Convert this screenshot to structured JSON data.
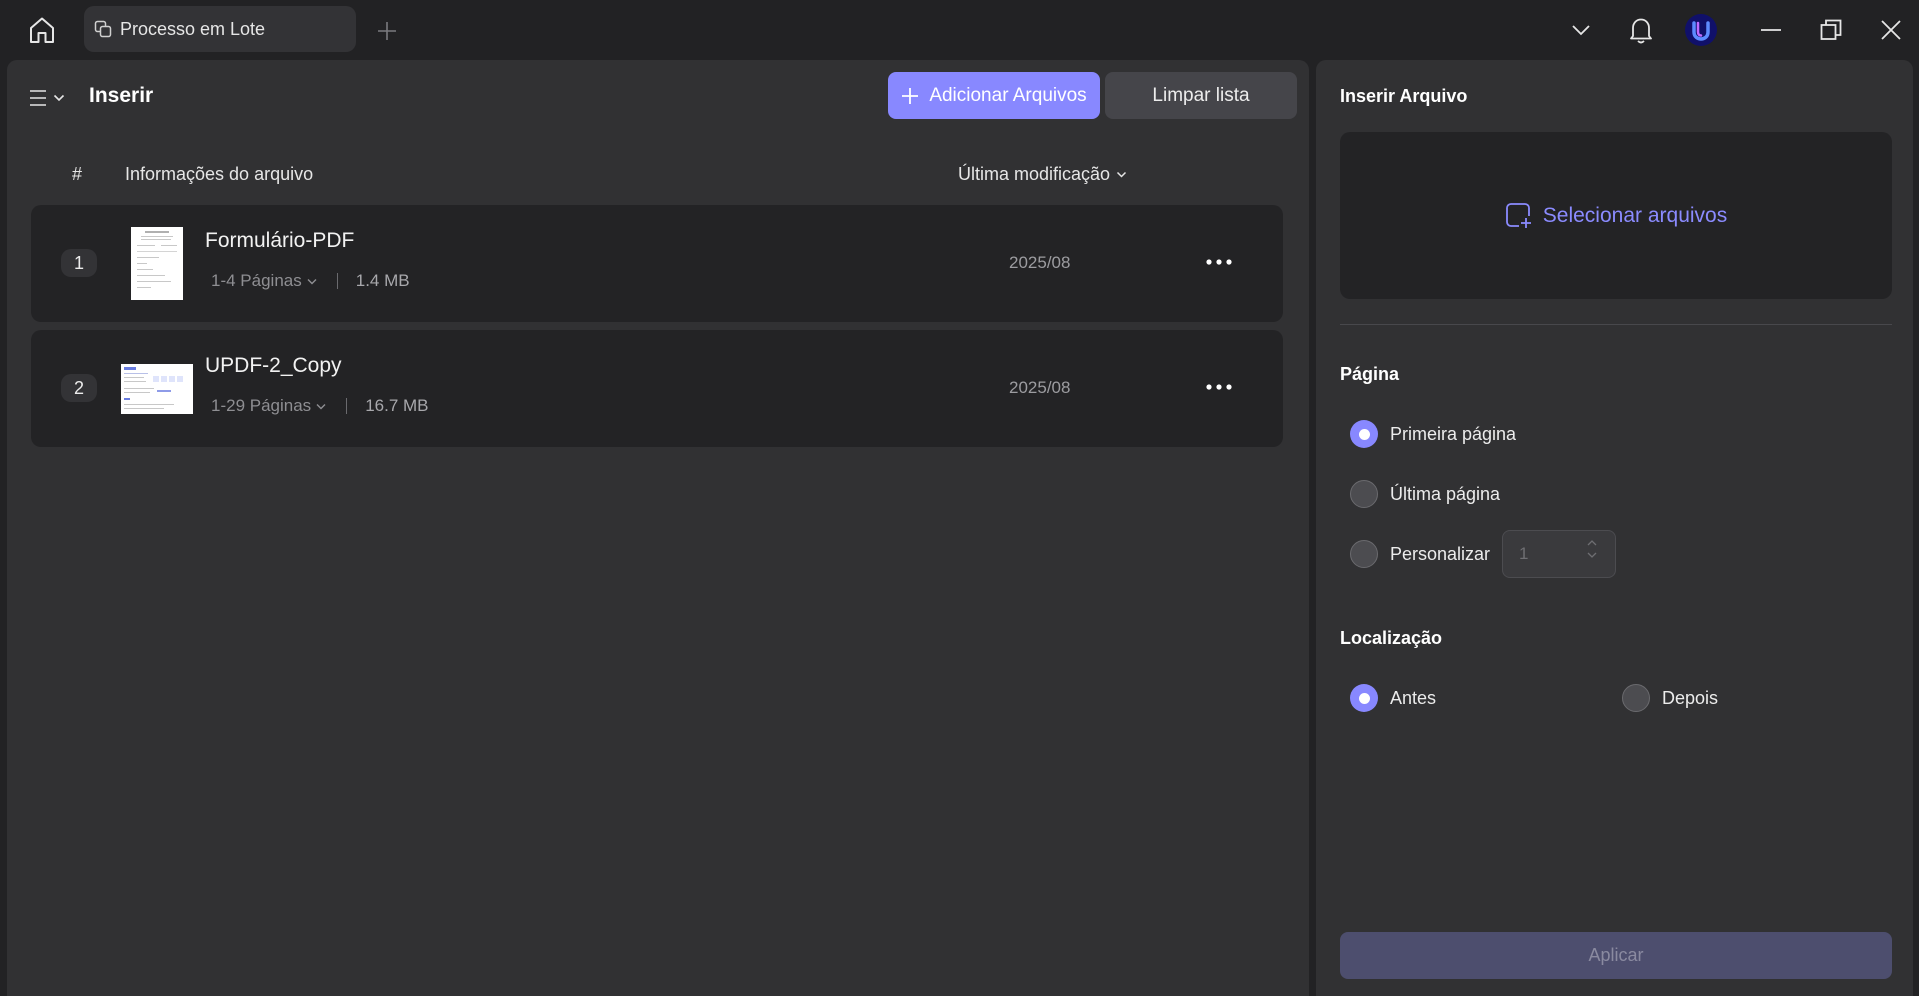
{
  "titlebar": {
    "tab_label": "Processo em Lote"
  },
  "toolbar": {
    "title": "Inserir",
    "add_files_label": "Adicionar Arquivos",
    "clear_list_label": "Limpar lista"
  },
  "table": {
    "col_number": "#",
    "col_info": "Informações do arquivo",
    "col_modified": "Última modificação"
  },
  "files": [
    {
      "index": "1",
      "name": "Formulário-PDF",
      "pages": "1-4 Páginas",
      "size": "1.4 MB",
      "date": "2025/08"
    },
    {
      "index": "2",
      "name": "UPDF-2_Copy",
      "pages": "1-29 Páginas",
      "size": "16.7 MB",
      "date": "2025/08"
    }
  ],
  "insert_panel": {
    "title": "Inserir Arquivo",
    "select_files_label": "Selecionar arquivos",
    "page_section": "Página",
    "page_options": [
      {
        "label": "Primeira página",
        "selected": true
      },
      {
        "label": "Última página",
        "selected": false
      },
      {
        "label": "Personalizar",
        "selected": false
      }
    ],
    "custom_page_value": "1",
    "location_section": "Localização",
    "location_options": [
      {
        "label": "Antes",
        "selected": true
      },
      {
        "label": "Depois",
        "selected": false
      }
    ],
    "apply_label": "Aplicar"
  },
  "colors": {
    "accent": "#8888ff",
    "background": "#222224",
    "panel": "#313133",
    "card": "#232325"
  }
}
